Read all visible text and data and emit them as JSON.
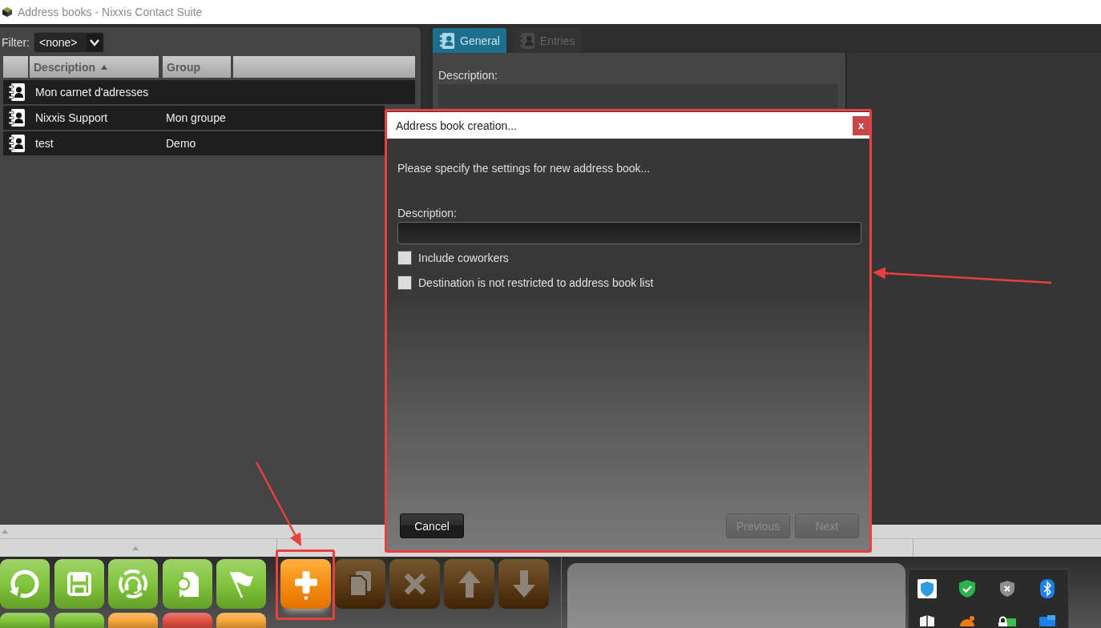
{
  "window": {
    "title": "Address books - Nixxis Contact Suite"
  },
  "filter": {
    "label": "Filter:",
    "value": "<none>"
  },
  "table": {
    "columns": [
      {
        "label": "Description",
        "sorted": true
      },
      {
        "label": "Group",
        "sorted": false
      }
    ],
    "rows": [
      {
        "description": "Mon carnet d'adresses"
      },
      {
        "description": "Nixxis Support",
        "group": "Mon groupe"
      },
      {
        "description": "test",
        "group": "Demo"
      }
    ]
  },
  "tabs": [
    {
      "label": "General",
      "selected": true
    },
    {
      "label": "Entries",
      "selected": false
    }
  ],
  "details": {
    "description_label": "Description:"
  },
  "dialog": {
    "title": "Address book creation...",
    "close_label": "x",
    "annotated": true,
    "intro": "Please specify the settings for new address book...",
    "description_label": "Description:",
    "options": [
      {
        "label": "Include coworkers",
        "checked": false
      },
      {
        "label": "Destination is not restricted to address book list",
        "checked": false
      }
    ],
    "buttons": [
      {
        "label": "Cancel",
        "disabled": false
      },
      {
        "label": "Previous",
        "disabled": true
      },
      {
        "label": "Next",
        "disabled": true
      }
    ]
  },
  "toolbar": {
    "nav_buttons": [
      {
        "color": "#7ac231"
      },
      {
        "color": "#7ac231"
      },
      {
        "color": "#7ac231"
      },
      {
        "color": "#7ac231"
      },
      {
        "color": "#7ac231"
      },
      {
        "color": "#7ac231"
      },
      {
        "color": "#7ac231"
      },
      {
        "color": "#f7a233"
      },
      {
        "color": "#e0473b"
      },
      {
        "color": "#f7a233"
      }
    ],
    "action_buttons": [
      {
        "disabled": false,
        "annotated": true
      },
      {
        "disabled": true,
        "annotated": false
      },
      {
        "disabled": true,
        "annotated": false
      },
      {
        "disabled": true,
        "annotated": false
      },
      {
        "disabled": true,
        "annotated": false
      }
    ]
  }
}
